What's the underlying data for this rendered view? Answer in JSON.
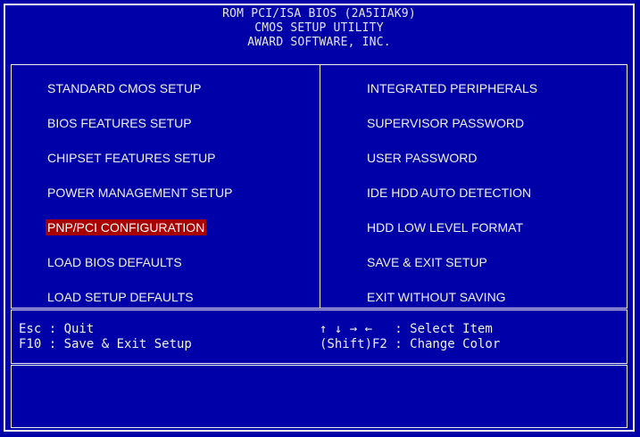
{
  "header": {
    "line1": "ROM PCI/ISA BIOS (2A5IIAK9)",
    "line2": "CMOS SETUP UTILITY",
    "line3": "AWARD SOFTWARE, INC."
  },
  "menu": {
    "left": [
      "STANDARD CMOS SETUP",
      "BIOS FEATURES SETUP",
      "CHIPSET FEATURES SETUP",
      "POWER MANAGEMENT SETUP",
      "PNP/PCI CONFIGURATION",
      "LOAD BIOS DEFAULTS",
      "LOAD SETUP DEFAULTS"
    ],
    "right": [
      "INTEGRATED PERIPHERALS",
      "SUPERVISOR PASSWORD",
      "USER PASSWORD",
      "IDE HDD AUTO DETECTION",
      "HDD LOW LEVEL FORMAT",
      "SAVE & EXIT SETUP",
      "EXIT WITHOUT SAVING"
    ],
    "selected": "PNP/PCI CONFIGURATION"
  },
  "help": {
    "left_line1": "Esc : Quit",
    "left_line2": "F10 : Save & Exit Setup",
    "right_line1": "↑ ↓ → ←   : Select Item",
    "right_line2": "(Shift)F2 : Change Color"
  },
  "status": {
    "text": ""
  },
  "colors": {
    "background": "#0000a8",
    "text": "#e8e8e8",
    "highlight": "#a80000"
  }
}
